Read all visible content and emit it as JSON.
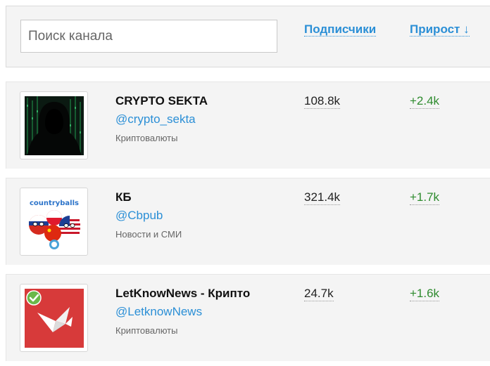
{
  "search": {
    "placeholder": "Поиск канала",
    "value": ""
  },
  "columns": {
    "subscribers_label": "Подписчики",
    "growth_label": "Прирост",
    "growth_sort_arrow": "↓"
  },
  "colors": {
    "link": "#2b8fd6",
    "growth": "#2e8b2e",
    "row_bg": "#f4f4f4"
  },
  "channels": [
    {
      "title": "CRYPTO SEKTA",
      "handle": "@crypto_sekta",
      "category": "Криптовалюты",
      "subscribers": "108.8k",
      "growth": "+2.4k",
      "avatar_icon": "hooded-hacker-avatar"
    },
    {
      "title": "КБ",
      "handle": "@Cbpub",
      "category": "Новости и СМИ",
      "subscribers": "321.4k",
      "growth": "+1.7k",
      "avatar_icon": "countryballs-avatar",
      "avatar_text": "countryballs"
    },
    {
      "title": "LetKnowNews - Крипто",
      "handle": "@LetknowNews",
      "category": "Криптовалюты",
      "subscribers": "24.7k",
      "growth": "+1.6k",
      "avatar_icon": "paper-bird-avatar"
    }
  ]
}
